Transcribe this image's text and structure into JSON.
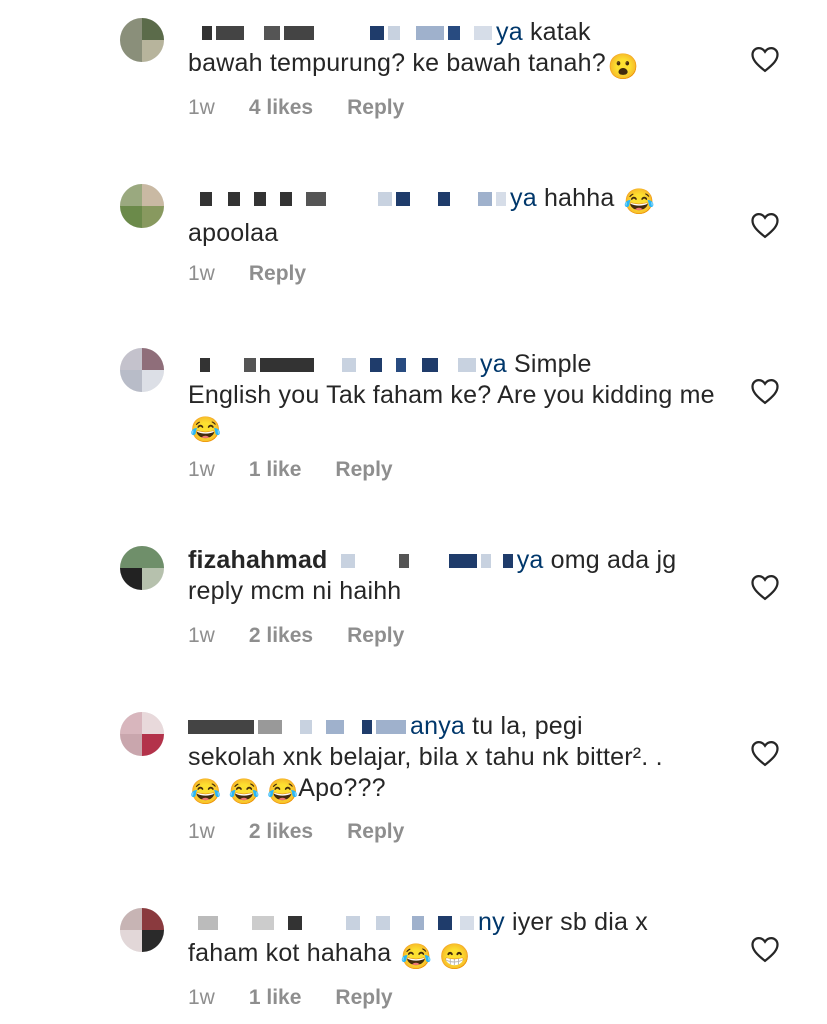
{
  "comments": [
    {
      "mention_tail": "ya",
      "text_line1": " katak",
      "text_rest": "bawah tempurung? ke bawah tanah?",
      "emoji": "😮",
      "time": "1w",
      "likes": "4 likes",
      "reply": "Reply"
    },
    {
      "mention_tail": "ya",
      "text_line1": " hahha",
      "text_rest": "apoolaa",
      "emoji": "😂",
      "time": "1w",
      "likes": "",
      "reply": "Reply"
    },
    {
      "mention_tail": "ya",
      "text_line1": " Simple",
      "text_rest": "English you Tak faham ke? Are you kidding me",
      "emoji": "😂",
      "time": "1w",
      "likes": "1 like",
      "reply": "Reply"
    },
    {
      "username": "fizahahmad",
      "mention_tail": "ya",
      "text_line1": " omg ada jg",
      "text_rest": "reply mcm ni haihh",
      "time": "1w",
      "likes": "2 likes",
      "reply": "Reply"
    },
    {
      "mention_tail": "anya",
      "text_line1": " tu la, pegi",
      "text_rest": "sekolah xnk belajar, bila x tahu nk bitter². .",
      "emoji_line": "😂 😂 😂 ",
      "tail_text": "Apo???",
      "time": "1w",
      "likes": "2 likes",
      "reply": "Reply"
    },
    {
      "mention_tail": "ny",
      "text_line1": " iyer sb dia x",
      "text_rest": "faham kot hahaha ",
      "emoji": "😂 😁",
      "time": "1w",
      "likes": "1 like",
      "reply": "Reply"
    }
  ],
  "icons": {
    "like": "heart-outline-icon"
  },
  "colors": {
    "text": "#262626",
    "meta": "#8e8e8e",
    "mention": "#00376b"
  }
}
